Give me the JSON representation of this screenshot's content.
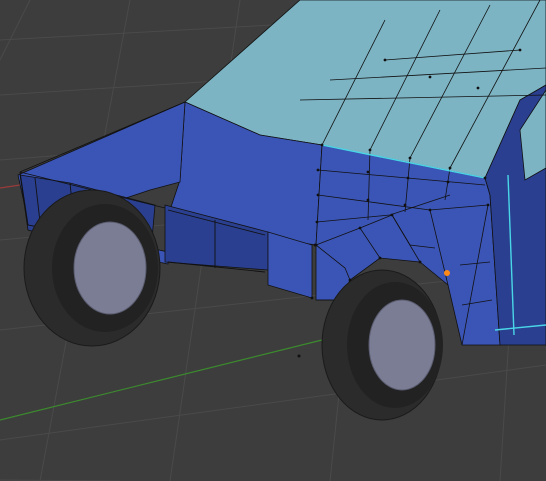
{
  "viewport": {
    "background_color": "#3d3d3d",
    "grid_color": "#4a4a4a",
    "x_axis_color": "#9a3a3a",
    "y_axis_color": "#3c8a2e"
  },
  "model": {
    "body_color": "#3b55b6",
    "body_dark_color": "#2a3f8f",
    "roof_color": "#7cb4c4",
    "wireframe_color": "#111111",
    "selected_edge_color": "#49d7e8",
    "active_vertex_color": "#ff8a1a",
    "tire_color": "#2b2b2b",
    "rim_color": "#7b7d95"
  }
}
